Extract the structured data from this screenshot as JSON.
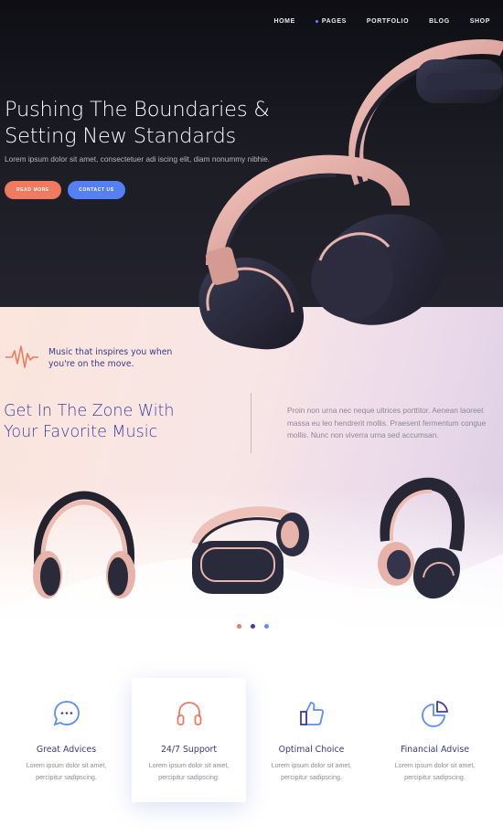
{
  "nav": {
    "items": [
      {
        "label": "HOME"
      },
      {
        "label": "PAGES"
      },
      {
        "label": "PORTFOLIO"
      },
      {
        "label": "BLOG"
      },
      {
        "label": "SHOP"
      }
    ],
    "active_dot_color": "#5a8dff"
  },
  "hero": {
    "title_line1": "Pushing The Boundaries &",
    "title_line2": "Setting New Standards",
    "subtitle": "Lorem ipsum dolor sit amet, consectetuer adi iscing elit, diam nonummy nibhie.",
    "read_more_label": "READ MORE",
    "contact_label": "CONTACT US",
    "read_more_color": "#ef7a5f",
    "contact_color": "#5580f5"
  },
  "intro": {
    "tagline": "Music that inspires you when you're on the move.",
    "heading_line1": "Get In The Zone With",
    "heading_line2": "Your Favorite Music",
    "description": "Proin non urna nec neque ultrices porttitor. Aenean laoreet massa eu leo hendrerit mollis. Praesent fermentum congue mollis. Nunc non viverra urna sed accumsan."
  },
  "carousel": {
    "dot_colors": [
      "#f07a62",
      "#3f3ea0",
      "#5a8dff"
    ]
  },
  "features": [
    {
      "title": "Great Advices",
      "text": "Lorem ipsum dolor sit amet, percipitur sadipscing.",
      "icon": "chat-bubble-icon"
    },
    {
      "title": "24/7 Support",
      "text": "Lorem ipsum dolor sit amet, percipitur sadipscing.",
      "icon": "headphones-icon"
    },
    {
      "title": "Optimal Choice",
      "text": "Lorem ipsum dolor sit amet, percipitur sadipscing.",
      "icon": "thumbs-up-icon"
    },
    {
      "title": "Financial Advise",
      "text": "Lorem ipsum dolor sit amet, percipitur sadipscing.",
      "icon": "pie-chart-icon"
    }
  ]
}
